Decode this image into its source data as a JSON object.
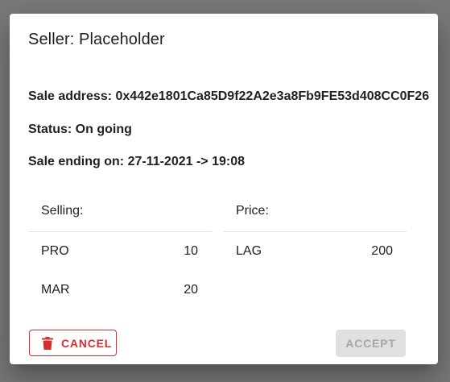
{
  "dialog": {
    "title": "Seller: Placeholder",
    "sale_address": "Sale address: 0x442e1801Ca85D9f22A2e3a8Fb9FE53d408CC0F26",
    "status": "Status: On going",
    "sale_ending": "Sale ending on: 27-11-2021 -> 19:08"
  },
  "selling": {
    "header": "Selling:",
    "items": [
      {
        "token": "PRO",
        "amount": "10"
      },
      {
        "token": "MAR",
        "amount": "20"
      }
    ]
  },
  "price": {
    "header": "Price:",
    "items": [
      {
        "token": "LAG",
        "amount": "200"
      }
    ]
  },
  "actions": {
    "cancel_label": "CANCEL",
    "cancel_icon": "trash-icon",
    "accept_label": "ACCEPT"
  },
  "colors": {
    "danger": "#d32f2f",
    "disabled_bg": "#e0e0e0",
    "disabled_text": "#a6a6a6"
  }
}
